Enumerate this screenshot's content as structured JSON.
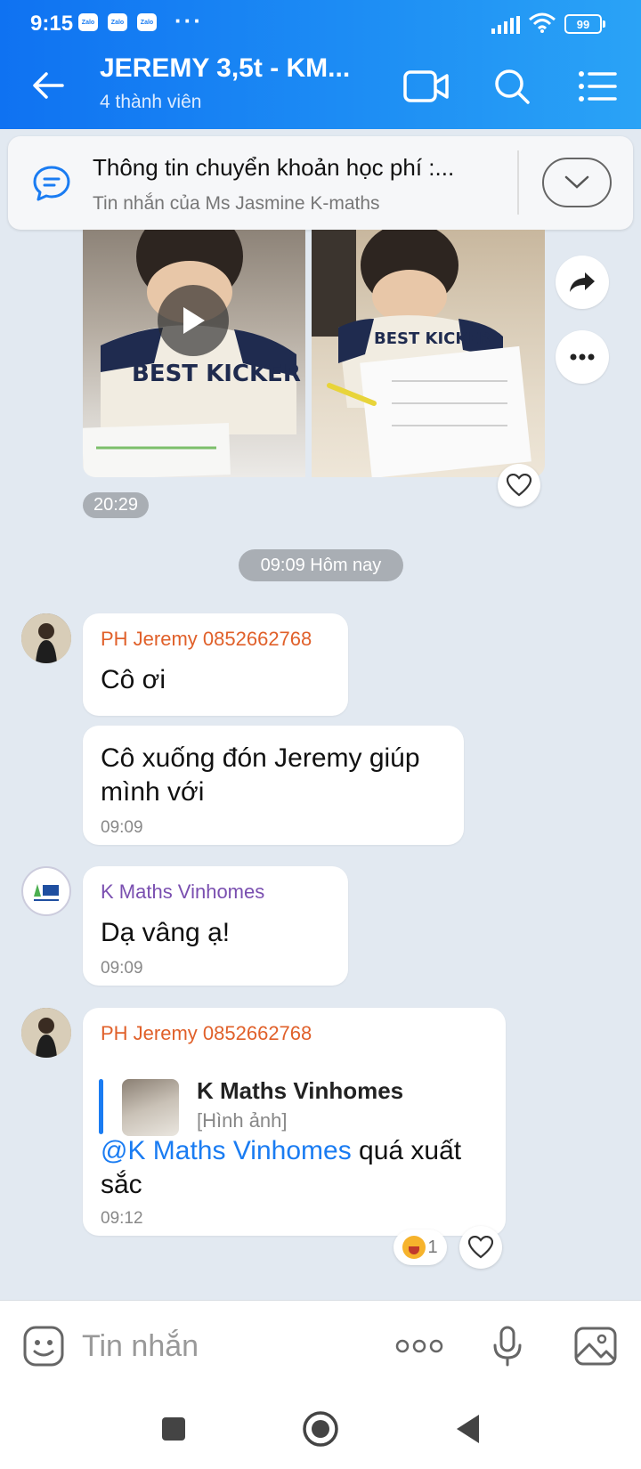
{
  "status_bar": {
    "time": "9:15",
    "notif_badges": [
      "Zalo",
      "Zalo",
      "Zalo"
    ],
    "more": "···",
    "battery": "99"
  },
  "header": {
    "title": "JEREMY 3,5t - KM...",
    "subtitle": "4 thành viên",
    "icons": [
      "back-arrow-icon",
      "video-call-icon",
      "search-icon",
      "menu-list-icon"
    ]
  },
  "pinned": {
    "title": "Thông tin chuyển khoản học phí :...",
    "subtitle": "Tin nhắn của Ms Jasmine K-maths"
  },
  "media_message": {
    "time": "20:29"
  },
  "date_divider": "09:09 Hôm nay",
  "messages": [
    {
      "sender": "PH Jeremy 0852662768",
      "text": "Cô ơi"
    },
    {
      "text_line1": "Cô xuống đón Jeremy giúp",
      "text_line2": "mình với",
      "time": "09:09"
    },
    {
      "sender": "K Maths Vinhomes",
      "text": "Dạ vâng ạ!",
      "time": "09:09"
    },
    {
      "sender": "PH Jeremy 0852662768",
      "quote_name": "K Maths Vinhomes",
      "quote_type": "[Hình ảnh]",
      "mention": "@K Maths Vinhomes",
      "text_after_mention": " quá xuất",
      "text_line2": "sắc",
      "time": "09:12",
      "reaction_count": "1"
    }
  ],
  "composer": {
    "placeholder": "Tin nhắn",
    "icons": [
      "sticker-icon",
      "more-options-icon",
      "microphone-icon",
      "image-icon"
    ]
  },
  "colors": {
    "header_blue": "#1a7cf2",
    "sender_orange": "#e0602a",
    "sender_purple": "#7a4fb0",
    "mention_blue": "#1a7cf2"
  }
}
